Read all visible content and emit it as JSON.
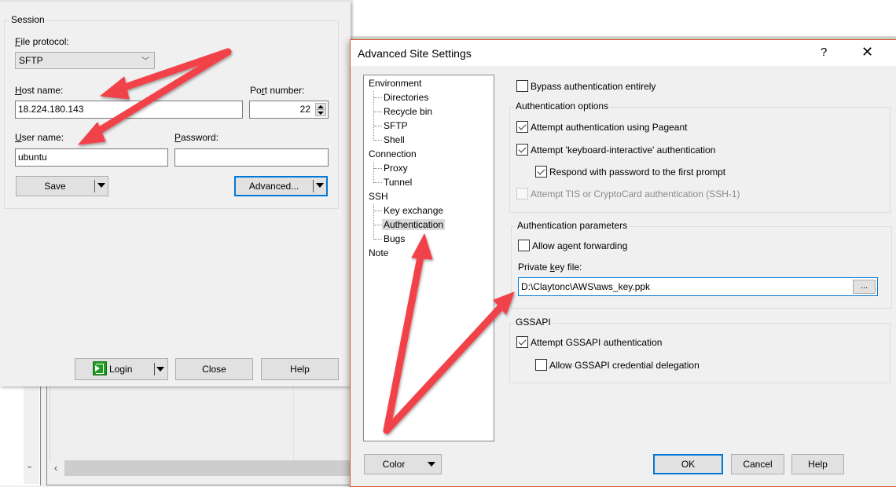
{
  "login_dialog": {
    "session_group": "Session",
    "file_protocol": {
      "label_u": "F",
      "label_rest": "ile protocol:",
      "value": "SFTP"
    },
    "host_name": {
      "label_u": "H",
      "label_rest": "ost name:",
      "value": "18.224.180.143"
    },
    "port_number": {
      "label_pre": "Po",
      "label_u": "r",
      "label_rest": "t number:",
      "value": "22"
    },
    "user_name": {
      "label_u": "U",
      "label_rest": "ser name:",
      "value": "ubuntu"
    },
    "password": {
      "label_u": "P",
      "label_rest": "assword:",
      "value": ""
    },
    "buttons": {
      "save": "Save",
      "advanced": "Advanced...",
      "login": "Login",
      "close": "Close",
      "help": "Help"
    }
  },
  "advanced_dialog": {
    "title": "Advanced Site Settings",
    "help_glyph": "?",
    "close_glyph": "✕",
    "tree": [
      {
        "label": "Environment",
        "level": 0
      },
      {
        "label": "Directories",
        "level": 1
      },
      {
        "label": "Recycle bin",
        "level": 1
      },
      {
        "label": "SFTP",
        "level": 1
      },
      {
        "label": "Shell",
        "level": 1
      },
      {
        "label": "Connection",
        "level": 0
      },
      {
        "label": "Proxy",
        "level": 1
      },
      {
        "label": "Tunnel",
        "level": 1
      },
      {
        "label": "SSH",
        "level": 0
      },
      {
        "label": "Key exchange",
        "level": 1
      },
      {
        "label": "Authentication",
        "level": 1,
        "selected": true
      },
      {
        "label": "Bugs",
        "level": 1
      },
      {
        "label": "Note",
        "level": 0
      }
    ],
    "bypass": {
      "label": "Bypass authentication entirely",
      "checked": false
    },
    "auth_options": {
      "title": "Authentication options",
      "pageant": {
        "label": "Attempt authentication using Pageant",
        "checked": true
      },
      "keyboard_interactive": {
        "label": "Attempt 'keyboard-interactive' authentication",
        "checked": true
      },
      "respond_password": {
        "label": "Respond with password to the first prompt",
        "checked": true
      },
      "tis": {
        "label": "Attempt TIS or CryptoCard authentication (SSH-1)",
        "checked": false,
        "disabled": true
      }
    },
    "auth_params": {
      "title": "Authentication parameters",
      "agent_forwarding": {
        "label": "Allow agent forwarding",
        "checked": false
      },
      "private_key": {
        "label_pre": "Private ",
        "label_u": "k",
        "label_rest": "ey file:",
        "value": "D:\\Claytonc\\AWS\\aws_key.ppk",
        "browse": "..."
      }
    },
    "gssapi": {
      "title": "GSSAPI",
      "attempt": {
        "label": "Attempt GSSAPI authentication",
        "checked": true
      },
      "delegation": {
        "label": "Allow GSSAPI credential delegation",
        "checked": false
      }
    },
    "buttons": {
      "color": "Color",
      "ok": "OK",
      "cancel": "Cancel",
      "help": "Help"
    }
  },
  "colors": {
    "accent": "#0078d7",
    "dialog_border": "#d75b2b",
    "annotation_arrow": "#f2424a"
  }
}
